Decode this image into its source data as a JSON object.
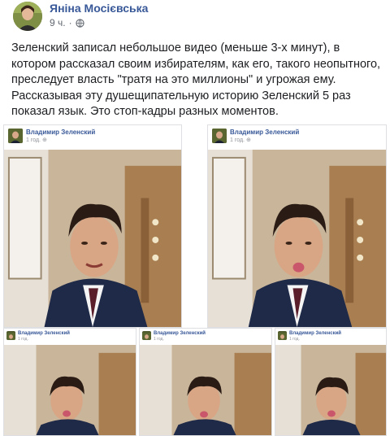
{
  "post": {
    "author_name": "Яніна Мосієвська",
    "time": "9 ч.",
    "privacy_icon": "globe-icon",
    "text": "Зеленский записал небольшое видео (меньше 3-х минут), в котором рассказал своим избирателям, как его, такого неопытного, преследует власть \"тратя на это миллионы\" и угрожая ему. Рассказывая эту душещипательную историю Зеленский 5 раз показал язык. Это стоп-кадры разных моментов."
  },
  "frames": [
    {
      "name": "Владимир Зеленский",
      "time": "1 год."
    },
    {
      "name": "Владимир Зеленский",
      "time": "1 год."
    },
    {
      "name": "Владимир Зеленский",
      "time": "1 год."
    },
    {
      "name": "Владимир Зеленский",
      "time": "1 год."
    },
    {
      "name": "Владимир Зеленский",
      "time": "1 год."
    }
  ],
  "colors": {
    "link": "#385898",
    "meta": "#616770",
    "suit": "#1f2a48",
    "tie": "#5a1e2a",
    "wall": "#b58c5e"
  }
}
